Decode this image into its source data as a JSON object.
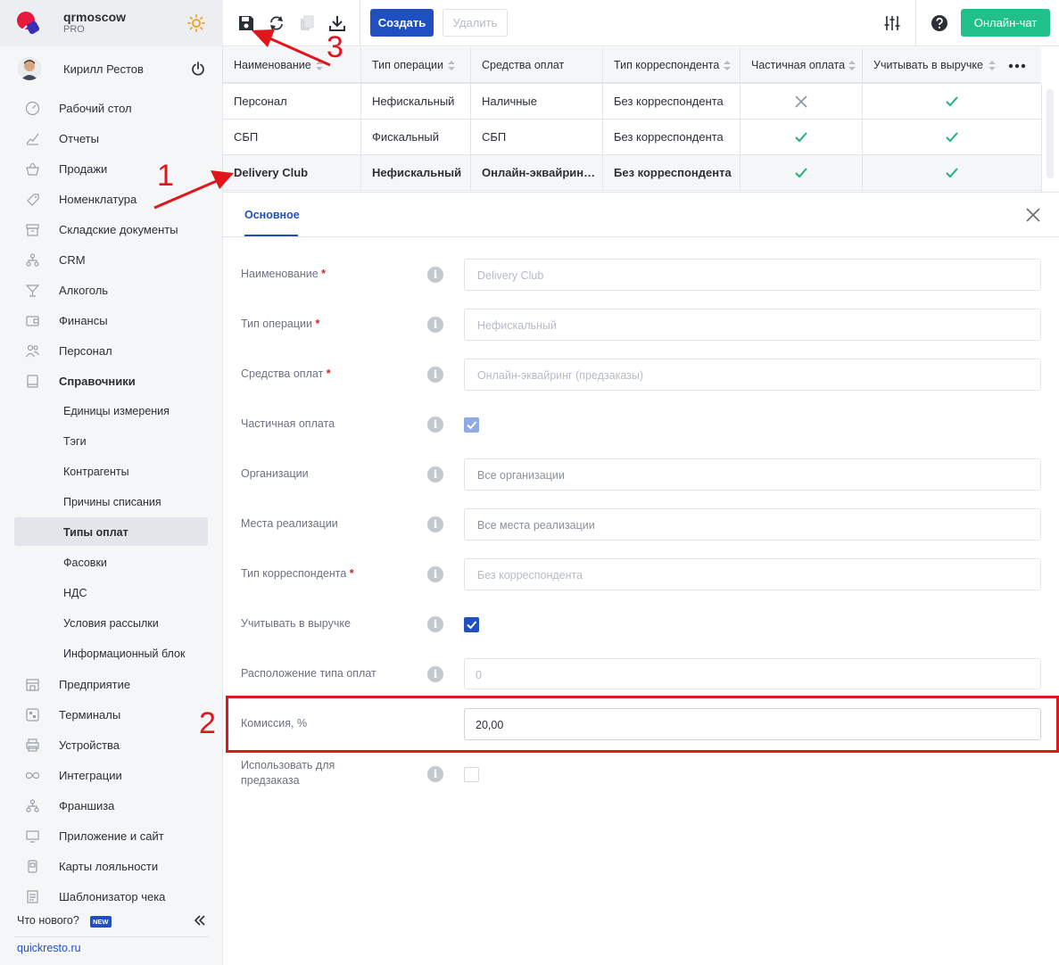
{
  "brand": {
    "name": "qrmoscow",
    "plan": "PRO"
  },
  "user": {
    "name": "Кирилл Рестов"
  },
  "nav": {
    "items": [
      {
        "label": "Рабочий стол"
      },
      {
        "label": "Отчеты"
      },
      {
        "label": "Продажи"
      },
      {
        "label": "Номенклатура"
      },
      {
        "label": "Складские документы"
      },
      {
        "label": "CRM"
      },
      {
        "label": "Алкоголь"
      },
      {
        "label": "Финансы"
      },
      {
        "label": "Персонал"
      },
      {
        "label": "Справочники"
      }
    ],
    "sub_items": [
      {
        "label": "Единицы измерения"
      },
      {
        "label": "Тэги"
      },
      {
        "label": "Контрагенты"
      },
      {
        "label": "Причины списания"
      },
      {
        "label": "Типы оплат"
      },
      {
        "label": "Фасовки"
      },
      {
        "label": "НДС"
      },
      {
        "label": "Условия рассылки"
      },
      {
        "label": "Информационный блок"
      }
    ],
    "items_after": [
      {
        "label": "Предприятие"
      },
      {
        "label": "Терминалы"
      },
      {
        "label": "Устройства"
      },
      {
        "label": "Интеграции"
      },
      {
        "label": "Франшиза"
      },
      {
        "label": "Приложение и сайт"
      },
      {
        "label": "Карты лояльности"
      },
      {
        "label": "Шаблонизатор чека"
      }
    ],
    "whats_new": "Что нового?",
    "new_badge": "NEW",
    "site_link": "quickresto.ru"
  },
  "toolbar": {
    "create_label": "Создать",
    "delete_label": "Удалить",
    "chat_label": "Онлайн-чат"
  },
  "table": {
    "columns": [
      "Наименование",
      "Тип операции",
      "Средства оплат",
      "Тип корреспондента",
      "Частичная оплата",
      "Учитывать в выручке"
    ],
    "rows": [
      {
        "name": "Персонал",
        "op_type": "Нефискальный",
        "payment": "Наличные",
        "corr": "Без корреспондента",
        "partial": "cross",
        "revenue": "check"
      },
      {
        "name": "СБП",
        "op_type": "Фискальный",
        "payment": "СБП",
        "corr": "Без корреспондента",
        "partial": "check",
        "revenue": "check"
      },
      {
        "name": "Delivery Club",
        "op_type": "Нефискальный",
        "payment": "Онлайн-эквайрин…",
        "corr": "Без корреспондента",
        "partial": "check",
        "revenue": "check"
      }
    ]
  },
  "panel": {
    "tab_label": "Основное",
    "fields": {
      "name": {
        "label": "Наименование",
        "value": "Delivery Club"
      },
      "op_type": {
        "label": "Тип операции",
        "value": "Нефискальный"
      },
      "payment": {
        "label": "Средства оплат",
        "value": "Онлайн-эквайринг (предзаказы)"
      },
      "partial": {
        "label": "Частичная оплата",
        "checked": true
      },
      "orgs": {
        "label": "Организации",
        "value": "Все организации"
      },
      "places": {
        "label": "Места реализации",
        "value": "Все места реализации"
      },
      "corr": {
        "label": "Тип корреспондента",
        "value": "Без корреспондента"
      },
      "revenue": {
        "label": "Учитывать в выручке",
        "checked": true
      },
      "position": {
        "label": "Расположение типа оплат",
        "value": "0"
      },
      "commission": {
        "label": "Комиссия, %",
        "value": "20,00"
      },
      "preorder": {
        "label_line1": "Использовать для",
        "label_line2": "предзаказа",
        "checked": false
      }
    },
    "required_mark": "*"
  },
  "annotations": {
    "one": "1",
    "two": "2",
    "three": "3"
  },
  "colors": {
    "accent": "#1f4fc1",
    "chat": "#21c08b",
    "annotation": "#e0161b",
    "check": "#21b07a"
  }
}
